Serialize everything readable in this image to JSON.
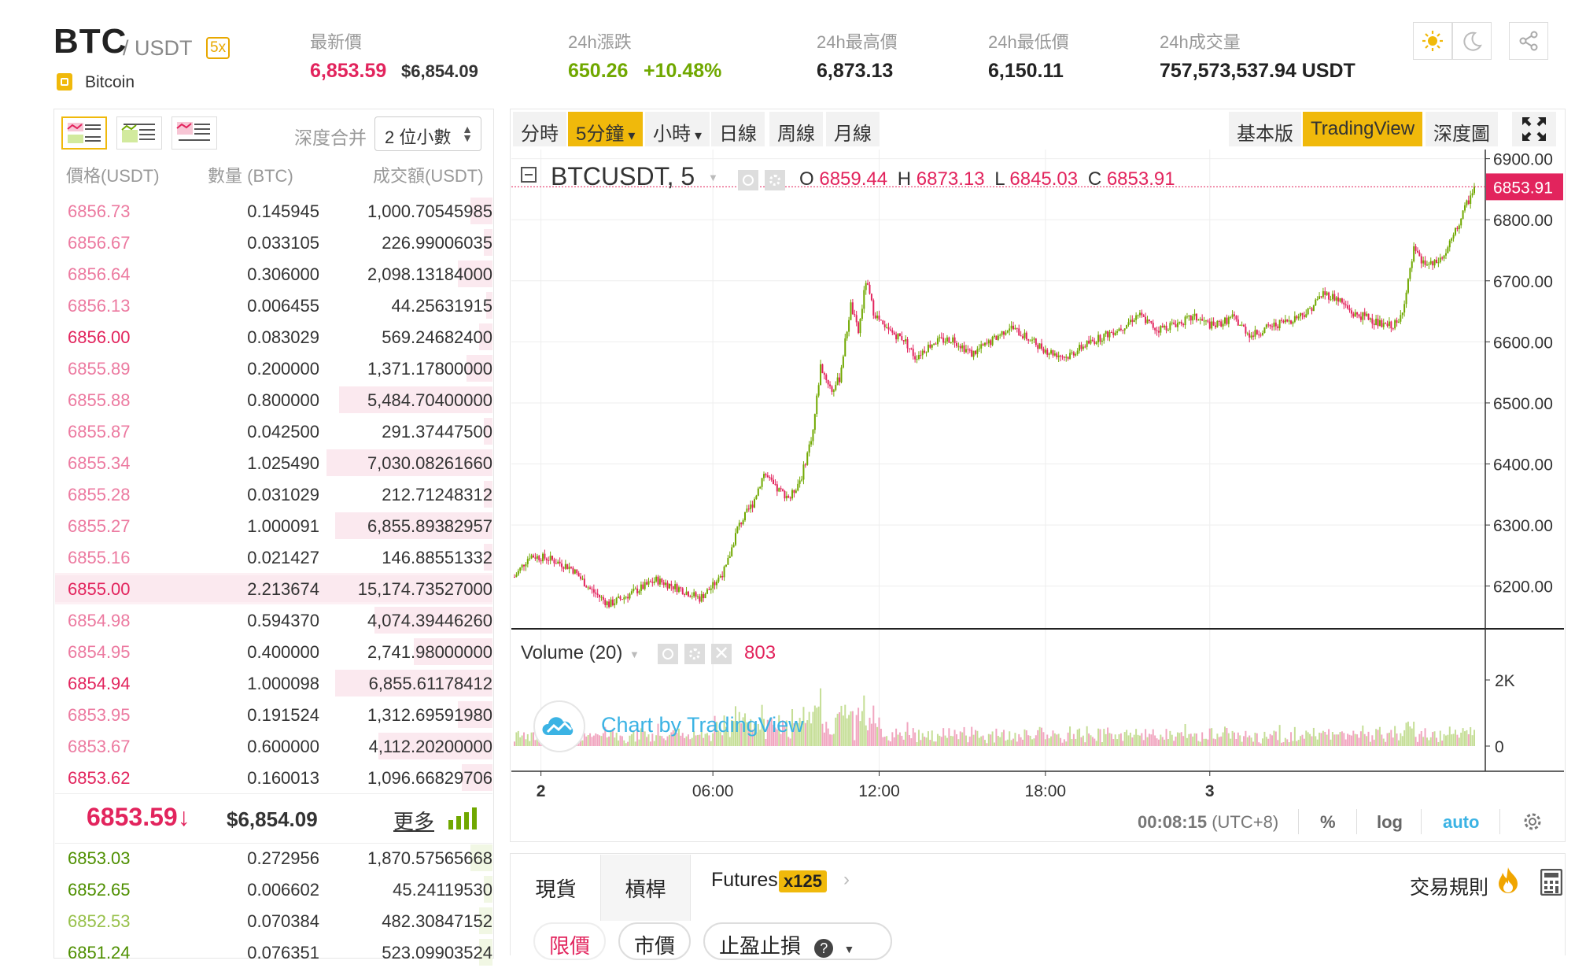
{
  "pair": {
    "base": "BTC",
    "quote": "/ USDT",
    "leverage": "5x",
    "coin_name": "Bitcoin"
  },
  "stats": {
    "last_label": "最新價",
    "last_price": "6,853.59",
    "last_usd": "$6,854.09",
    "change_label": "24h漲跌",
    "change_value": "650.26",
    "change_pct": "+10.48%",
    "high_label": "24h最高價",
    "high_value": "6,873.13",
    "low_label": "24h最低價",
    "low_value": "6,150.11",
    "vol_label": "24h成交量",
    "vol_value": "757,573,537.94 USDT"
  },
  "theme": {
    "accent": "#f0b90b",
    "sell": "#e2245d",
    "buy": "#70a800"
  },
  "orderbook": {
    "depth_label": "深度合并",
    "depth_value": "2 位小數",
    "col_price": "價格(USDT)",
    "col_qty": "數量 (BTC)",
    "col_total": "成交額(USDT)",
    "asks": [
      {
        "p": "6856.73",
        "q": "0.145945",
        "t": "1,000.70545985",
        "d": 0.05,
        "strong": false
      },
      {
        "p": "6856.67",
        "q": "0.033105",
        "t": "226.99006035",
        "d": 0.02,
        "strong": false
      },
      {
        "p": "6856.64",
        "q": "0.306000",
        "t": "2,098.13184000",
        "d": 0.08,
        "strong": false
      },
      {
        "p": "6856.13",
        "q": "0.006455",
        "t": "44.25631915",
        "d": 0.01,
        "strong": false
      },
      {
        "p": "6856.00",
        "q": "0.083029",
        "t": "569.24682400",
        "d": 0.03,
        "strong": true
      },
      {
        "p": "6855.89",
        "q": "0.200000",
        "t": "1,371.17800000",
        "d": 0.06,
        "strong": false
      },
      {
        "p": "6855.88",
        "q": "0.800000",
        "t": "5,484.70400000",
        "d": 0.35,
        "strong": false
      },
      {
        "p": "6855.87",
        "q": "0.042500",
        "t": "291.37447500",
        "d": 0.02,
        "strong": false
      },
      {
        "p": "6855.34",
        "q": "1.025490",
        "t": "7,030.08261660",
        "d": 0.38,
        "strong": false
      },
      {
        "p": "6855.28",
        "q": "0.031029",
        "t": "212.71248312",
        "d": 0.02,
        "strong": false
      },
      {
        "p": "6855.27",
        "q": "1.000091",
        "t": "6,855.89382957",
        "d": 0.36,
        "strong": false
      },
      {
        "p": "6855.16",
        "q": "0.021427",
        "t": "146.88551332",
        "d": 0.02,
        "strong": false
      },
      {
        "p": "6855.00",
        "q": "2.213674",
        "t": "15,174.73527000",
        "d": 1.0,
        "strong": true
      },
      {
        "p": "6854.98",
        "q": "0.594370",
        "t": "4,074.39446260",
        "d": 0.27,
        "strong": false
      },
      {
        "p": "6854.95",
        "q": "0.400000",
        "t": "2,741.98000000",
        "d": 0.18,
        "strong": false
      },
      {
        "p": "6854.94",
        "q": "1.000098",
        "t": "6,855.61178412",
        "d": 0.36,
        "strong": true
      },
      {
        "p": "6853.95",
        "q": "0.191524",
        "t": "1,312.69591980",
        "d": 0.08,
        "strong": false
      },
      {
        "p": "6853.67",
        "q": "0.600000",
        "t": "4,112.20200000",
        "d": 0.26,
        "strong": false
      },
      {
        "p": "6853.62",
        "q": "0.160013",
        "t": "1,096.66829706",
        "d": 0.07,
        "strong": true
      }
    ],
    "mid_price": "6853.59↓",
    "mid_usd": "$6,854.09",
    "more_label": "更多",
    "bids": [
      {
        "p": "6853.03",
        "q": "0.272956",
        "t": "1,870.57565668",
        "d": 0.05,
        "strong": true
      },
      {
        "p": "6852.65",
        "q": "0.006602",
        "t": "45.24119530",
        "d": 0.02,
        "strong": true
      },
      {
        "p": "6852.53",
        "q": "0.070384",
        "t": "482.30847152",
        "d": 0.03,
        "strong": false
      },
      {
        "p": "6851.24",
        "q": "0.076351",
        "t": "523.09903524",
        "d": 0.03,
        "strong": true
      }
    ]
  },
  "chart_toolbar": {
    "intervals": [
      "分時",
      "5分鐘",
      "小時",
      "日線",
      "周線",
      "月線"
    ],
    "active_interval": "5分鐘",
    "views": [
      "基本版",
      "TradingView",
      "深度圖"
    ],
    "active_view": "TradingView"
  },
  "legend": {
    "symbol": "BTCUSDT, 5",
    "o_label": "O",
    "o": "6859.44",
    "h_label": "H",
    "h": "6873.13",
    "l_label": "L",
    "l": "6845.03",
    "c_label": "C",
    "c": "6853.91",
    "last_tag": "6853.91",
    "volume_label": "Volume (20)",
    "volume_value": "803",
    "watermark": "Chart by TradingView"
  },
  "footer": {
    "time": "00:08:15",
    "tz": "(UTC+8)",
    "pct": "%",
    "log": "log",
    "auto": "auto"
  },
  "bottom": {
    "tab_spot": "現貨",
    "tab_margin": "槓桿",
    "tab_futures": "Futures",
    "futures_badge": "x125",
    "rules": "交易規則",
    "order_limit": "限價",
    "order_market": "市價",
    "order_stop": "止盈止損"
  },
  "chart_data": {
    "type": "candlestick",
    "title": "BTCUSDT, 5",
    "xlabel": "",
    "ylabel": "",
    "x_ticks": [
      "2",
      "06:00",
      "12:00",
      "18:00",
      "3"
    ],
    "y_ticks": [
      "6900.00",
      "6800.00",
      "6700.00",
      "6600.00",
      "6500.00",
      "6400.00",
      "6300.00",
      "6200.00"
    ],
    "ylim": [
      6130,
      6915
    ],
    "volume_ticks": [
      "2K",
      "0"
    ],
    "volume_ylim": [
      0,
      3000
    ],
    "grid": true,
    "anchors": [
      [
        0,
        6215
      ],
      [
        8,
        6250
      ],
      [
        18,
        6245
      ],
      [
        30,
        6230
      ],
      [
        40,
        6195
      ],
      [
        50,
        6170
      ],
      [
        60,
        6185
      ],
      [
        75,
        6210
      ],
      [
        88,
        6195
      ],
      [
        98,
        6180
      ],
      [
        105,
        6200
      ],
      [
        112,
        6230
      ],
      [
        118,
        6295
      ],
      [
        126,
        6335
      ],
      [
        132,
        6385
      ],
      [
        138,
        6360
      ],
      [
        146,
        6345
      ],
      [
        152,
        6380
      ],
      [
        158,
        6455
      ],
      [
        162,
        6560
      ],
      [
        168,
        6520
      ],
      [
        172,
        6540
      ],
      [
        178,
        6660
      ],
      [
        182,
        6615
      ],
      [
        186,
        6700
      ],
      [
        190,
        6650
      ],
      [
        196,
        6620
      ],
      [
        206,
        6605
      ],
      [
        212,
        6575
      ],
      [
        222,
        6600
      ],
      [
        232,
        6605
      ],
      [
        242,
        6580
      ],
      [
        252,
        6600
      ],
      [
        262,
        6625
      ],
      [
        272,
        6605
      ],
      [
        282,
        6585
      ],
      [
        292,
        6575
      ],
      [
        302,
        6595
      ],
      [
        312,
        6610
      ],
      [
        322,
        6625
      ],
      [
        330,
        6645
      ],
      [
        340,
        6620
      ],
      [
        350,
        6630
      ],
      [
        360,
        6640
      ],
      [
        370,
        6625
      ],
      [
        380,
        6640
      ],
      [
        390,
        6610
      ],
      [
        400,
        6625
      ],
      [
        410,
        6635
      ],
      [
        420,
        6650
      ],
      [
        428,
        6680
      ],
      [
        436,
        6670
      ],
      [
        444,
        6645
      ],
      [
        452,
        6640
      ],
      [
        460,
        6625
      ],
      [
        468,
        6630
      ],
      [
        472,
        6680
      ],
      [
        476,
        6750
      ],
      [
        480,
        6730
      ],
      [
        486,
        6725
      ],
      [
        492,
        6740
      ],
      [
        498,
        6780
      ],
      [
        504,
        6825
      ],
      [
        508,
        6854
      ]
    ]
  }
}
